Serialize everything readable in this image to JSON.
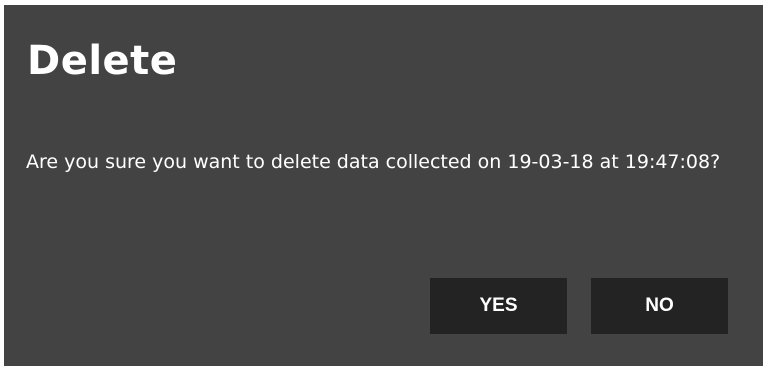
{
  "dialog": {
    "title": "Delete",
    "message": "Are you sure you want to delete data collected on 19-03-18 at 19:47:08?",
    "yes_label": "YES",
    "no_label": "NO"
  },
  "colors": {
    "dialog_background": "#434343",
    "button_background": "#232323",
    "text": "#ffffff"
  }
}
